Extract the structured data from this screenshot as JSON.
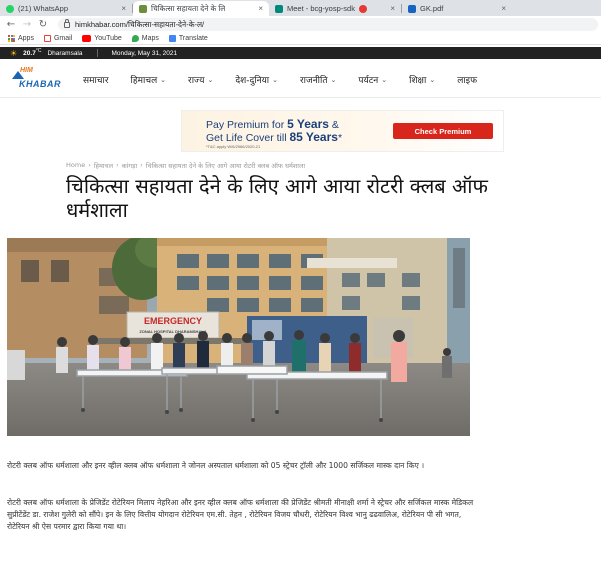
{
  "browser": {
    "tabs": [
      {
        "label": "(21) WhatsApp",
        "active": false,
        "icon": "whatsapp-icon"
      },
      {
        "label": "चिकित्सा सहायता देने के लि",
        "active": true,
        "icon": "site-favicon"
      },
      {
        "label": "Meet - bcg-yosp-sdk",
        "active": false,
        "icon": "meet-icon"
      },
      {
        "label": "GK.pdf",
        "active": false,
        "icon": "pdf-icon"
      }
    ],
    "url": "himkhabar.com/चिकित्सा-सहायता-देने-के-ल/",
    "bookmarks": [
      {
        "label": "Apps",
        "icon": "apps-icon"
      },
      {
        "label": "Gmail",
        "icon": "gmail-icon"
      },
      {
        "label": "YouTube",
        "icon": "youtube-icon"
      },
      {
        "label": "Maps",
        "icon": "maps-icon"
      },
      {
        "label": "Translate",
        "icon": "translate-icon"
      }
    ]
  },
  "topbar": {
    "temperature": "20.7",
    "unit": "°C",
    "location": "Dharamsala",
    "date": "Monday, May 31, 2021"
  },
  "site": {
    "logo_top": "HIM",
    "logo_bottom": "KHABAR",
    "nav": [
      {
        "label": "समाचार",
        "dropdown": false
      },
      {
        "label": "हिमाचल",
        "dropdown": true
      },
      {
        "label": "राज्य",
        "dropdown": true
      },
      {
        "label": "देश-दुनिया",
        "dropdown": true
      },
      {
        "label": "राजनीति",
        "dropdown": true
      },
      {
        "label": "पर्यटन",
        "dropdown": true
      },
      {
        "label": "शिक्षा",
        "dropdown": true
      },
      {
        "label": "लाइफ",
        "dropdown": false
      }
    ]
  },
  "ad": {
    "line1_prefix": "Pay Premium for ",
    "line1_bold": "5 Years",
    "line1_suffix": " &",
    "line2_prefix": "Get Life Cover till ",
    "line2_bold": "85 Years",
    "line2_suffix": "*",
    "fine_print": "*T&C apply W/6/2966/2020-21",
    "button": "Check Premium"
  },
  "breadcrumb": [
    "Home",
    "हिमाचल",
    "कांगड़ा",
    "चिकित्सा सहायता देने के लिए आगे आया रोटरी क्लब ऑफ धर्मशाला"
  ],
  "article": {
    "title": "चिकित्सा सहायता देने के लिए आगे आया रोटरी क्लब ऑफ धर्मशाला",
    "photo_sign": "EMERGENCY",
    "photo_sign_sub": "ZONAL HOSPITAL DHARAMSHALA",
    "paragraph1": "रोटरी क्लब ऑफ धर्मशाला और इनर व्हील क्लब ऑफ धर्मशाला ने जोनल अस्पताल धर्मशाला को 05 स्ट्रेचर ट्रॉली और 1000 सर्जिकल मास्क दान किए ।",
    "paragraph2": "रोटरी क्लब ऑफ धर्मशाला के प्रेजिडेंट रोटेरियन मिलाप नेहरिआ और इनर व्हील क्लब ऑफ धर्मशाला की प्रेजिडेंट श्रीमती मीनाक्षी शर्मा ने स्ट्रेचर और सर्जिकल मास्क मेडिकल सुप्रीटेंडेंट डा. राजेश गुलेरी को सौंपे। इन के लिए वित्तीय योगदान रोटेरियन एम.सी. तेहन , रोटेरियन विजय चौधरी, रोटेरियन विश्व भानु ढढवालिअ, रोटेरियन पी सी भगत, रोटेरियन श्री ऐस परमार द्वारा किया गया था।"
  }
}
